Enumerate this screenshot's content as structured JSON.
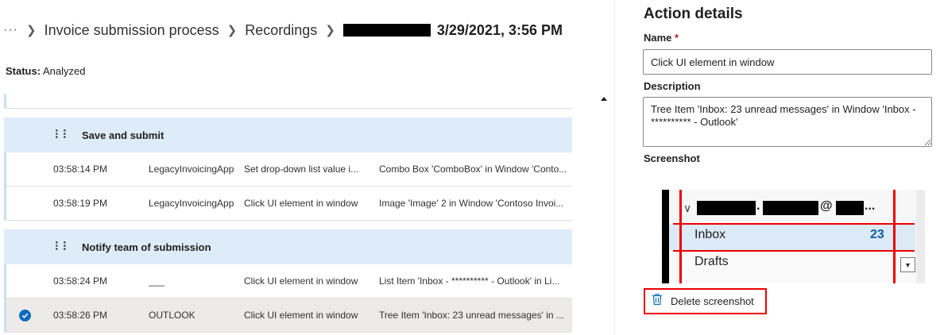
{
  "breadcrumb": {
    "more": "···",
    "items": [
      "Invoice submission process",
      "Recordings"
    ],
    "current": "3/29/2021, 3:56 PM"
  },
  "status": {
    "label": "Status:",
    "value": "Analyzed"
  },
  "groups": [
    {
      "title": "Save and submit",
      "rows": [
        {
          "time": "03:58:14 PM",
          "app": "LegacyInvoicingApp",
          "action": "Set drop-down list value i...",
          "details": "Combo Box 'ComboBox' in Window 'Conto..."
        },
        {
          "time": "03:58:19 PM",
          "app": "LegacyInvoicingApp",
          "action": "Click UI element in window",
          "details": "Image 'Image' 2 in Window 'Contoso Invoi..."
        }
      ]
    },
    {
      "title": "Notify team of submission",
      "rows": [
        {
          "time": "03:58:24 PM",
          "app": "___",
          "action": "Click UI element in window",
          "details": "List Item 'Inbox - ********** - Outlook' in Li..."
        },
        {
          "time": "03:58:26 PM",
          "app": "OUTLOOK",
          "action": "Click UI element in window",
          "details": "Tree Item 'Inbox: 23 unread messages' in ..."
        }
      ]
    }
  ],
  "panel": {
    "title": "Action details",
    "name_label": "Name",
    "required_mark": "*",
    "name_value": "Click UI element in window",
    "description_label": "Description",
    "description_value": "Tree Item 'Inbox: 23 unread messages' in Window 'Inbox - ********** - Outlook'",
    "screenshot_label": "Screenshot",
    "screenshot": {
      "dot": ".",
      "at": "@",
      "ellipsis": "...",
      "inbox": "Inbox",
      "inbox_count": "23",
      "drafts": "Drafts"
    },
    "delete_label": "Delete screenshot"
  },
  "colors": {
    "accent": "#0f6cbd",
    "group_bg": "#deecf9",
    "selected_bg": "#edebe9",
    "highlight_red": "#e00000"
  },
  "icons": {
    "check": "checkmark-circle-icon",
    "grip": "gripper-dots-icon",
    "delete": "trash-icon"
  }
}
